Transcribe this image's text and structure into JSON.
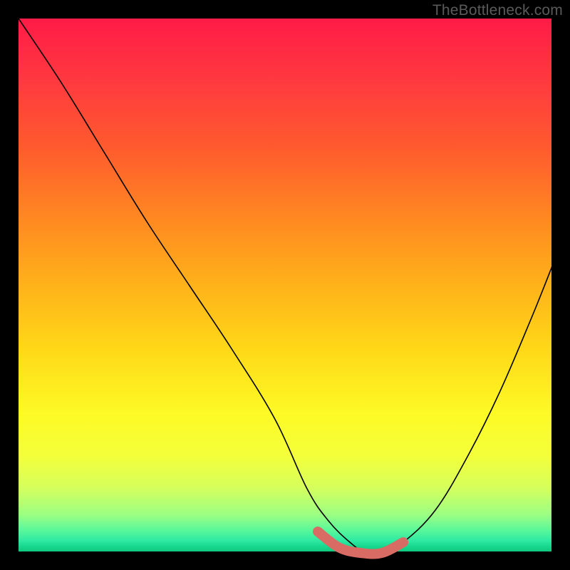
{
  "watermark": "TheBottleneck.com",
  "chart_data": {
    "type": "line",
    "title": "",
    "xlabel": "",
    "ylabel": "",
    "xlim": [
      0,
      100
    ],
    "ylim": [
      0,
      100
    ],
    "grid": false,
    "legend": false,
    "series": [
      {
        "name": "bottleneck-curve",
        "x": [
          0,
          8,
          16,
          24,
          32,
          40,
          48,
          54,
          58,
          62,
          65,
          68,
          72,
          78,
          84,
          90,
          96,
          100
        ],
        "y": [
          100,
          88,
          75,
          62,
          50,
          38,
          25,
          12,
          6,
          2,
          0,
          0,
          2,
          8,
          18,
          30,
          44,
          54
        ],
        "color": "#000000"
      },
      {
        "name": "sweet-spot-marker",
        "x": [
          56,
          60,
          64,
          68,
          72
        ],
        "y": [
          4,
          1,
          0,
          0,
          2
        ],
        "color": "#d86c64"
      }
    ],
    "background_gradient": {
      "top": "#ff1b47",
      "mid": "#ffd818",
      "bottom": "#10c97e"
    }
  }
}
